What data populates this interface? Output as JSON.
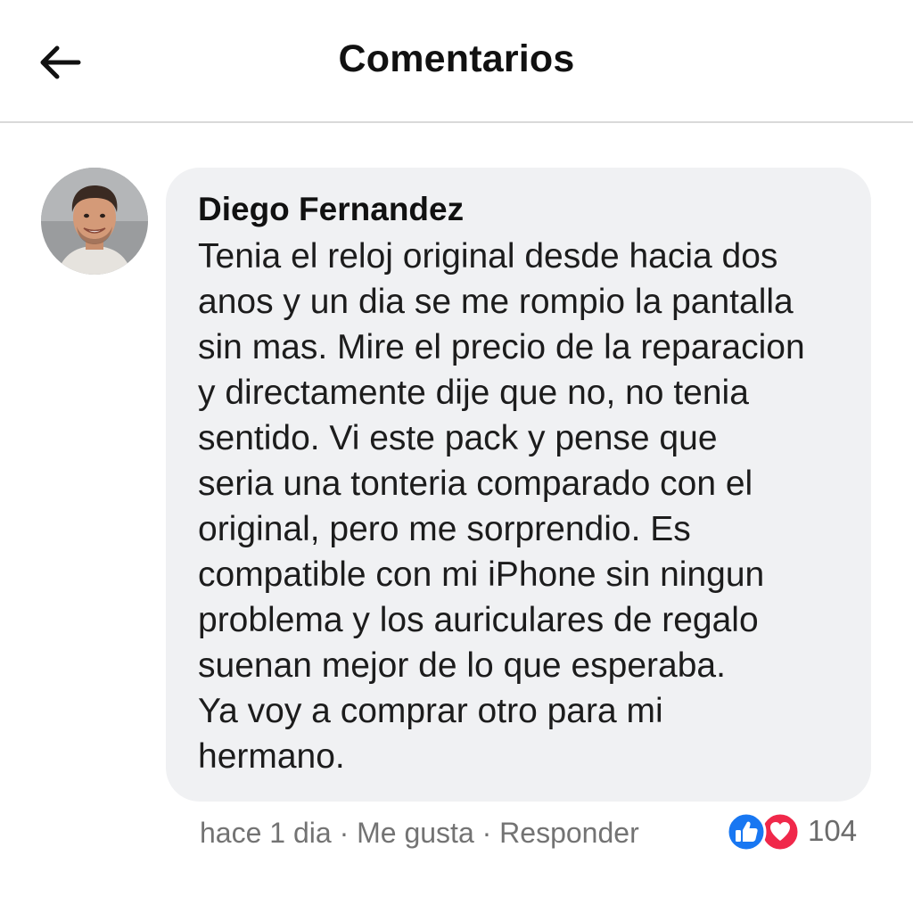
{
  "header": {
    "title": "Comentarios",
    "back_icon": "arrow-left-icon"
  },
  "comment": {
    "author": "Diego Fernandez",
    "text": "Tenia el reloj original desde hacia dos\nanos y un dia se me rompio la pantalla\nsin mas. Mire el precio de la reparacion\ny directamente dije que no, no tenia\nsentido. Vi este pack y pense que\nseria una tonteria comparado con el\noriginal, pero me sorprendio. Es\ncompatible con mi iPhone sin ningun\nproblema y los auriculares de regalo\nsuenan mejor de lo que esperaba.\nYa voy a comprar otro para mi\nhermano.",
    "time": "hace 1 dia",
    "separator": " · ",
    "like_label": "Me gusta",
    "reply_label": "Responder",
    "reaction_count": "104",
    "reaction_icons": [
      "thumbs-up-icon",
      "heart-icon"
    ]
  },
  "colors": {
    "bubble": "#f0f1f3",
    "like_blue": "#1877f2",
    "love_red": "#f0284a",
    "meta_text": "#737373"
  }
}
